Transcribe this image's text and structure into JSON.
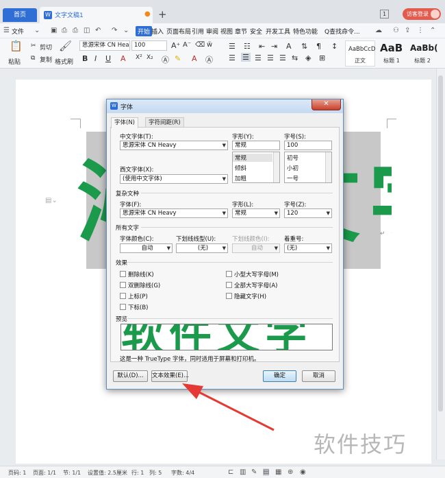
{
  "tabs": {
    "home": "首页",
    "doc_name": "文字文稿1",
    "doc_badge": "W",
    "plus": "+",
    "window_count": "1",
    "guest_login": "访客登录"
  },
  "menu": {
    "file": "文件",
    "items": [
      "开始",
      "插入",
      "页面布局",
      "引用",
      "审阅",
      "视图",
      "章节",
      "安全",
      "开发工具",
      "特色功能"
    ],
    "active": "开始",
    "search": "Q查找命令..."
  },
  "ribbon": {
    "paste": "粘贴",
    "cut": "剪切",
    "copy": "复制",
    "format_painter": "格式刷",
    "font_name": "思源宋体 CN Hea",
    "font_size": "100",
    "bold": "B",
    "italic": "I",
    "underline": "U",
    "font_color": "A",
    "superscript": "X²",
    "subscript": "X₂",
    "styles": [
      {
        "sample": "AaBbCcD",
        "name": "正文"
      },
      {
        "sample": "AaB",
        "name": "标题 1"
      },
      {
        "sample": "AaBb(",
        "name": "标题 2"
      }
    ]
  },
  "document": {
    "big_text": "沁水文字"
  },
  "dialog": {
    "title": "字体",
    "app_icon": "W",
    "close": "✕",
    "tabs": [
      "字体(N)",
      "字符间距(R)"
    ],
    "cn_font_label": "中文字体(T):",
    "cn_font_value": "思源宋体 CN Heavy",
    "style_label": "字形(Y):",
    "style_value": "常规",
    "style_options": [
      "常规",
      "倾斜",
      "加粗"
    ],
    "size_label": "字号(S):",
    "size_value": "100",
    "size_options": [
      "初号",
      "小初",
      "一号"
    ],
    "west_font_label": "西文字体(X):",
    "west_font_value": "(使用中文字体)",
    "complex_section": "复杂文种",
    "complex_font_label": "字体(F):",
    "complex_font_value": "思源宋体 CN Heavy",
    "complex_style_label": "字形(L):",
    "complex_style_value": "常规",
    "complex_size_label": "字号(Z):",
    "complex_size_value": "120",
    "all_text_section": "所有文字",
    "font_color_label": "字体颜色(C):",
    "font_color_value": "自动",
    "underline_style_label": "下划线线型(U):",
    "underline_style_value": "(无)",
    "underline_color_label": "下划线颜色(I):",
    "underline_color_value": "自动",
    "emphasis_label": "着重号:",
    "emphasis_value": "(无)",
    "effects_section": "效果",
    "effects_left": [
      "删除线(K)",
      "双删除线(G)",
      "上标(P)",
      "下标(B)"
    ],
    "effects_right": [
      "小型大写字母(M)",
      "全部大写字母(A)",
      "隐藏文字(H)"
    ],
    "preview_section": "预览",
    "preview_text": "软件文字",
    "note": "这是一种 TrueType 字体，同时适用于屏幕和打印机。",
    "default_button": "默认(D)...",
    "text_effect_button": "文本效果(E)...",
    "ok_button": "确定",
    "cancel_button": "取消"
  },
  "status": {
    "page_no": "页码: 1",
    "page_count": "页面: 1/1",
    "section": "节: 1/1",
    "setting": "设置值: 2.5厘米",
    "row": "行: 1",
    "col": "列: 5",
    "words": "字数: 4/4"
  },
  "watermark": "软件技巧",
  "colors": {
    "accent": "#2e6ed5",
    "doc_text": "#1a9a4a",
    "arrow": "#e53935",
    "guest": "#e25b4c"
  }
}
